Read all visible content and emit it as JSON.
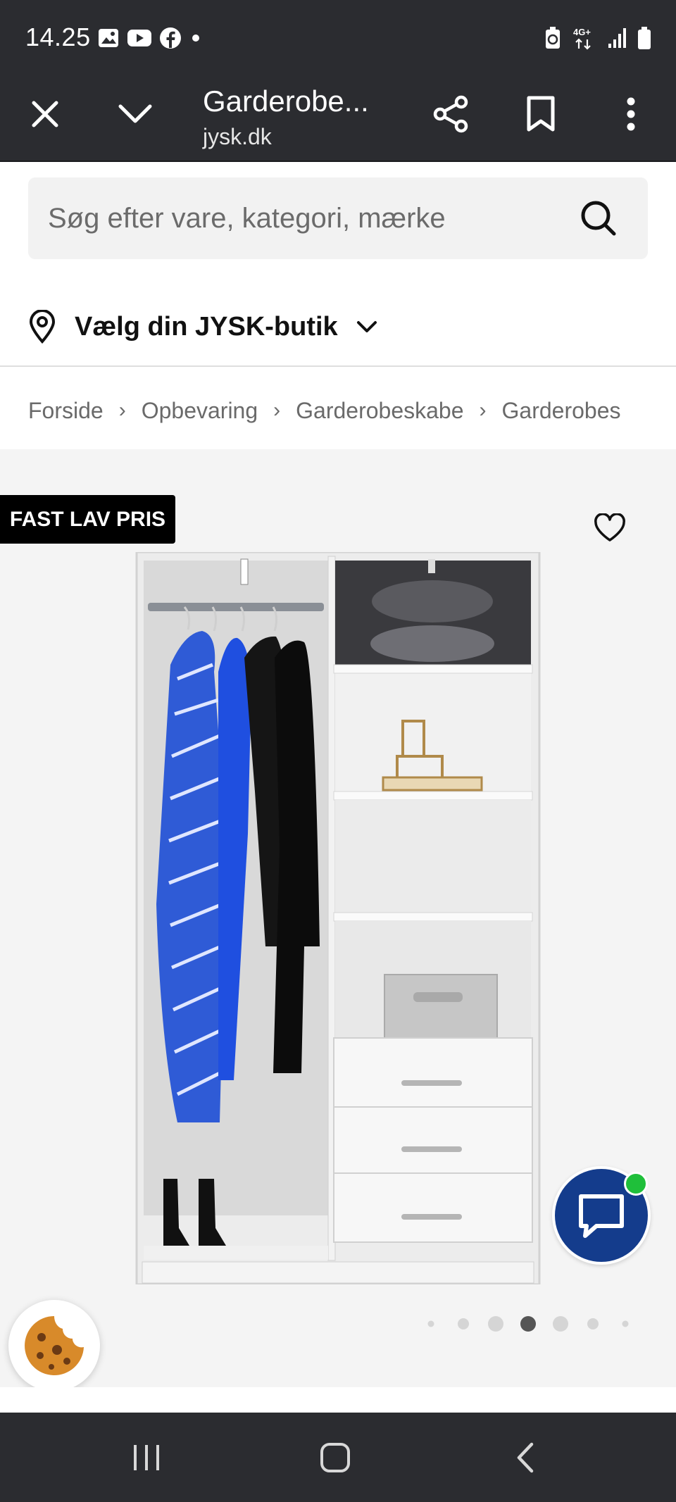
{
  "status_bar": {
    "time": "14.25",
    "left_icons": [
      "gallery-icon",
      "youtube-icon",
      "facebook-icon",
      "dot-icon"
    ],
    "right_icons": [
      "battery-saver-icon",
      "4g-icon",
      "signal-icon",
      "battery-icon"
    ],
    "network_label": "4G+"
  },
  "browser": {
    "tab_title": "Garderobe...",
    "domain": "jysk.dk"
  },
  "search": {
    "placeholder": "Søg efter vare, kategori, mærke"
  },
  "store": {
    "label": "Vælg din JYSK-butik"
  },
  "breadcrumb": {
    "items": [
      "Forside",
      "Opbevaring",
      "Garderobeskabe",
      "Garderobes"
    ],
    "separator": "›"
  },
  "product": {
    "badge": "FAST LAV PRIS",
    "carousel_dots": 7,
    "carousel_active_index": 3
  },
  "colors": {
    "system_bar": "#2b2c30",
    "chat_button": "#143c8c",
    "online_dot": "#1fbf3a",
    "badge_bg": "#000000"
  }
}
